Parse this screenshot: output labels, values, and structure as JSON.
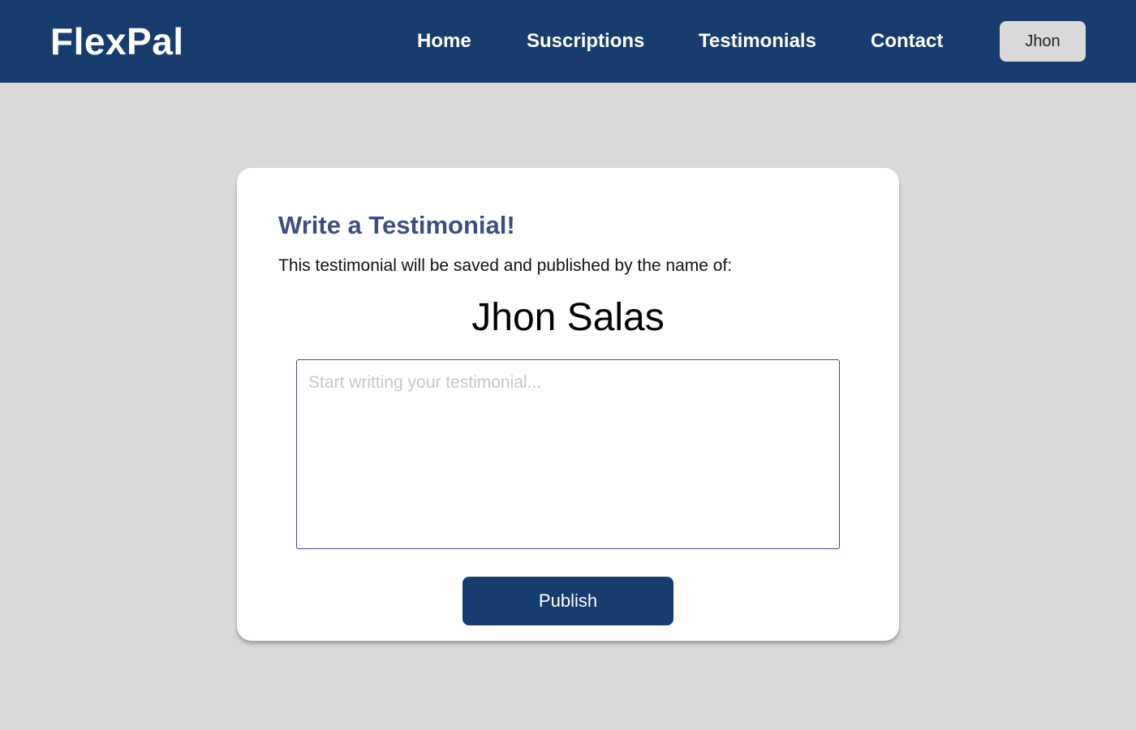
{
  "navbar": {
    "logo": "FlexPal",
    "links": [
      {
        "label": "Home"
      },
      {
        "label": "Suscriptions"
      },
      {
        "label": "Testimonials"
      },
      {
        "label": "Contact"
      }
    ],
    "user_button_label": "Jhon"
  },
  "testimonial_form": {
    "title": "Write a Testimonial!",
    "description": "This testimonial will be saved and published by the name of:",
    "author_name": "Jhon Salas",
    "input_value": "",
    "input_placeholder": "Start writting your testimonial...",
    "publish_label": "Publish"
  },
  "colors": {
    "navbar_bg": "#163d6e",
    "page_bg": "#d9d9d9",
    "title_color": "#3d4f80",
    "button_bg": "#163d6e"
  }
}
